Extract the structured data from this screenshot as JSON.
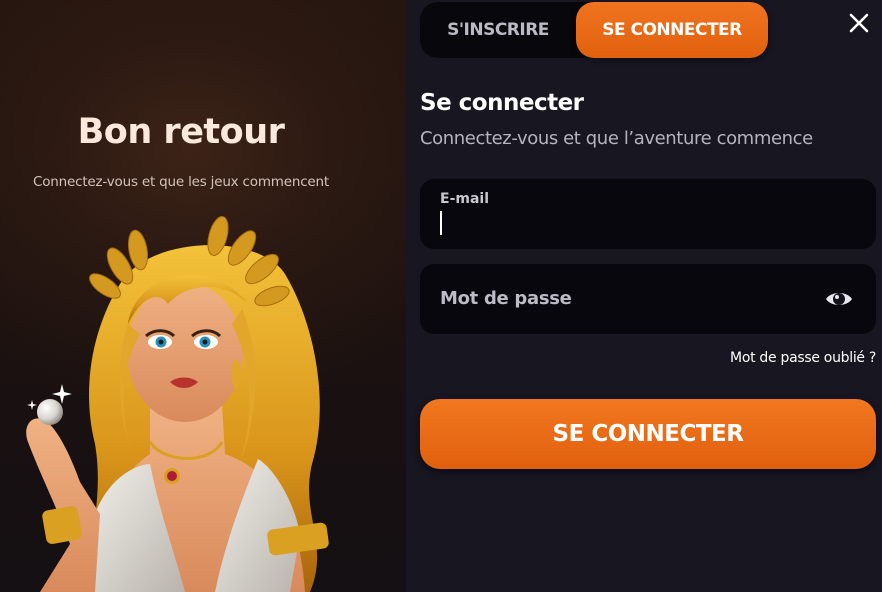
{
  "promo": {
    "title": "Bon retour",
    "subtitle": "Connectez-vous et que les jeux commencent",
    "hero_icon": "goddess-illustration"
  },
  "tabs": {
    "signup_label": "S'INSCRIRE",
    "login_label": "SE CONNECTER",
    "active": "login"
  },
  "close_icon": "close-icon",
  "form": {
    "title": "Se connecter",
    "subtitle": "Connectez-vous et que l’aventure commence",
    "email": {
      "label": "E-mail",
      "value": ""
    },
    "password": {
      "placeholder": "Mot de passe",
      "icon": "eye-icon"
    },
    "forgot_label": "Mot de passe oublié ?",
    "submit_label": "SE CONNECTER"
  },
  "colors": {
    "accent": "#f06c1a",
    "panel": "#171621",
    "field": "#08070d",
    "promo_bg": "#24140f"
  }
}
